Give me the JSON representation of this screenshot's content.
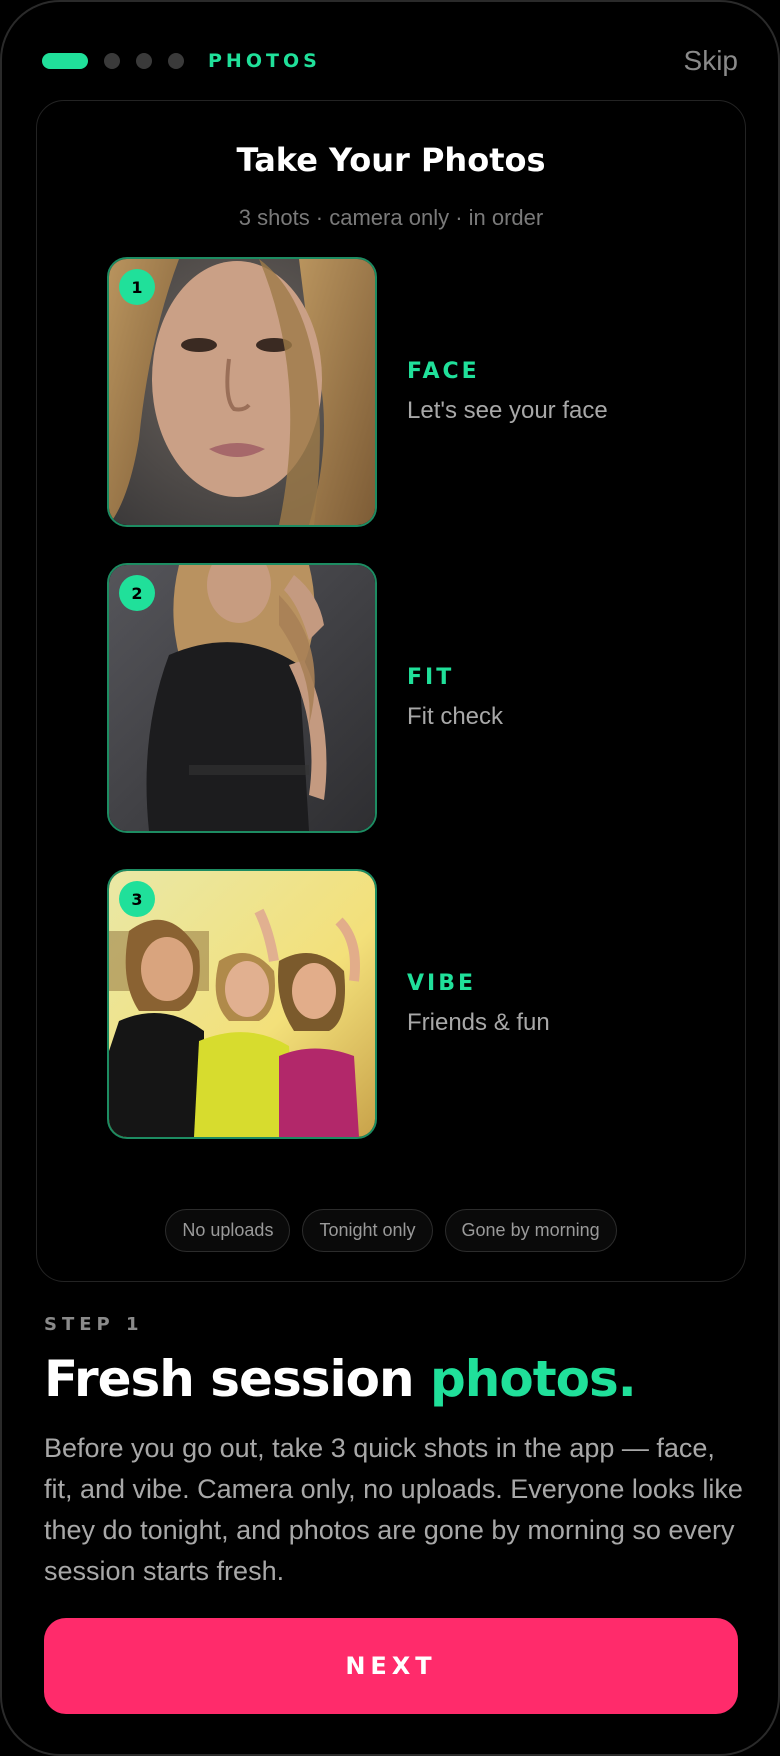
{
  "header": {
    "step_label": "PHOTOS",
    "skip_label": "Skip",
    "progress_total": 4,
    "progress_current": 1
  },
  "card": {
    "title": "Take Your Photos",
    "subtitle": "3 shots · camera only · in order",
    "shots": [
      {
        "number": "1",
        "title": "FACE",
        "description": "Let's see your face"
      },
      {
        "number": "2",
        "title": "FIT",
        "description": "Fit check"
      },
      {
        "number": "3",
        "title": "VIBE",
        "description": "Friends & fun"
      }
    ],
    "chips": [
      "No uploads",
      "Tonight only",
      "Gone by morning"
    ]
  },
  "intro": {
    "step": "STEP 1",
    "headline_main": "Fresh session ",
    "headline_accent": "photos.",
    "body": "Before you go out, take 3 quick shots in the app — face, fit, and vibe. Camera only, no uploads. Everyone looks like they do tonight, and photos are gone by morning so every session starts fresh."
  },
  "actions": {
    "next_label": "NEXT"
  },
  "colors": {
    "accent": "#20e09a",
    "primary_button": "#ff2b6b",
    "background": "#000000"
  }
}
